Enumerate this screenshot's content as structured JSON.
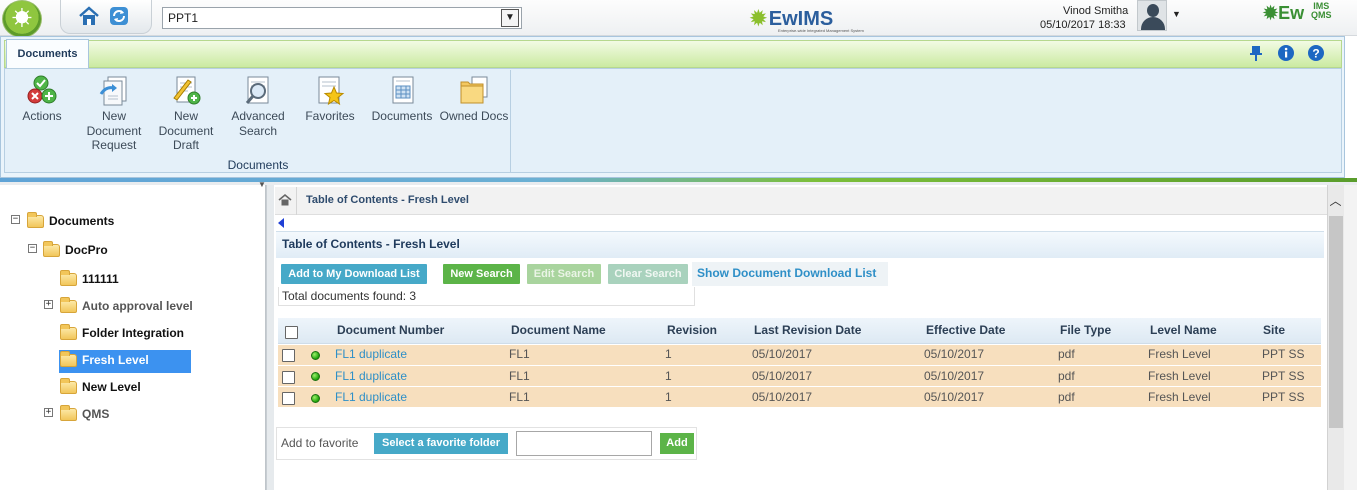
{
  "app": {
    "site_selector_value": "PPT1",
    "brand_center": "EwIMS",
    "brand_center_tagline": "Enterprise-wide Integrated Management System",
    "brand_right": "Ew",
    "brand_right_suffix_top": "IMS",
    "brand_right_suffix_bottom": "QMS",
    "user_name": "Vinod Smitha",
    "user_datetime": "05/10/2017 18:33"
  },
  "ribbon": {
    "active_tab": "Documents",
    "group_label": "Documents",
    "buttons": [
      {
        "label": "Actions",
        "icon": "actions-icon"
      },
      {
        "label": "New Document Request",
        "icon": "new-document-request-icon"
      },
      {
        "label": "New Document Draft",
        "icon": "new-document-draft-icon"
      },
      {
        "label": "Advanced Search",
        "icon": "advanced-search-icon"
      },
      {
        "label": "Favorites",
        "icon": "favorites-icon"
      },
      {
        "label": "Documents",
        "icon": "documents-icon"
      },
      {
        "label": "Owned Docs",
        "icon": "owned-docs-icon"
      }
    ],
    "right_icons": [
      "pin-icon",
      "info-icon",
      "help-icon"
    ]
  },
  "tree": {
    "nodes": [
      {
        "label": "Documents",
        "expander": "−"
      },
      {
        "label": "DocPro",
        "expander": "−"
      },
      {
        "label": "111111",
        "expander": ""
      },
      {
        "label": "Auto approval level",
        "expander": "+"
      },
      {
        "label": "Folder Integration",
        "expander": ""
      },
      {
        "label": "Fresh Level",
        "expander": "",
        "selected": true
      },
      {
        "label": "New Level",
        "expander": ""
      },
      {
        "label": "QMS",
        "expander": "+"
      }
    ]
  },
  "main": {
    "breadcrumb": "Table of Contents - Fresh Level",
    "section_title": "Table of Contents - Fresh Level",
    "buttons": {
      "add_download": "Add to My Download List",
      "new_search": "New Search",
      "edit_search": "Edit Search",
      "clear_search": "Clear Search",
      "show_download": "Show Document Download List"
    },
    "found_text": "Total documents found: 3",
    "columns": [
      "Document Number",
      "Document Name",
      "Revision",
      "Last Revision Date",
      "Effective Date",
      "File Type",
      "Level Name",
      "Site"
    ],
    "rows": [
      {
        "number": "FL1 duplicate",
        "name": "FL1",
        "revision": "1",
        "last_rev": "05/10/2017",
        "effective": "05/10/2017",
        "type": "pdf",
        "level": "Fresh Level",
        "site": "PPT SS"
      },
      {
        "number": "FL1 duplicate",
        "name": "FL1",
        "revision": "1",
        "last_rev": "05/10/2017",
        "effective": "05/10/2017",
        "type": "pdf",
        "level": "Fresh Level",
        "site": "PPT SS"
      },
      {
        "number": "FL1 duplicate",
        "name": "FL1",
        "revision": "1",
        "last_rev": "05/10/2017",
        "effective": "05/10/2017",
        "type": "pdf",
        "level": "Fresh Level",
        "site": "PPT SS"
      }
    ],
    "favorite": {
      "label": "Add to favorite",
      "select_button": "Select a favorite folder",
      "input_value": "",
      "add_button": "Add"
    }
  },
  "colors": {
    "accent_blue": "#46a9c8",
    "accent_green": "#5cb448",
    "row_highlight": "#f7dfbe",
    "tree_selected": "#3c92f0",
    "link": "#2e8fc7"
  }
}
